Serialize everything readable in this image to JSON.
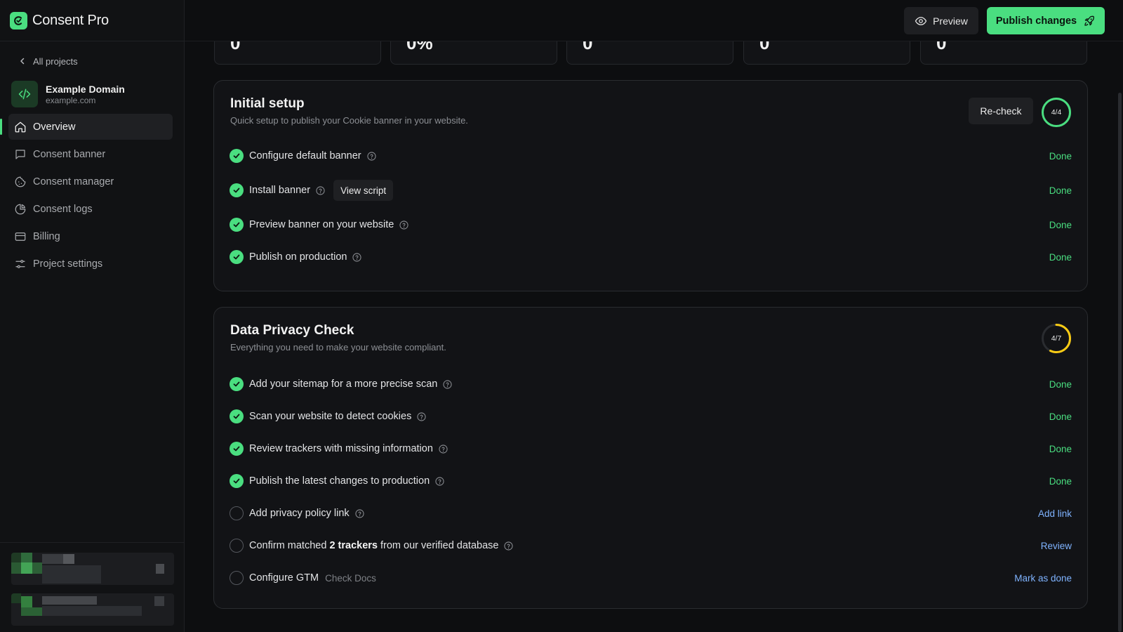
{
  "app": {
    "name": "Consent Pro"
  },
  "sidebar": {
    "back_label": "All projects",
    "project": {
      "name": "Example Domain",
      "domain": "example.com"
    },
    "items": [
      {
        "label": "Overview",
        "icon": "home-icon",
        "active": true
      },
      {
        "label": "Consent banner",
        "icon": "message-square-icon",
        "active": false
      },
      {
        "label": "Consent manager",
        "icon": "cookie-icon",
        "active": false
      },
      {
        "label": "Consent logs",
        "icon": "pie-chart-icon",
        "active": false
      },
      {
        "label": "Billing",
        "icon": "credit-card-icon",
        "active": false
      },
      {
        "label": "Project settings",
        "icon": "sliders-icon",
        "active": false
      }
    ]
  },
  "topbar": {
    "preview_label": "Preview",
    "publish_label": "Publish changes"
  },
  "stats": [
    {
      "value": "0"
    },
    {
      "value": "0%"
    },
    {
      "value": "0"
    },
    {
      "value": "0"
    },
    {
      "value": "0"
    }
  ],
  "initial_setup": {
    "title": "Initial setup",
    "subtitle": "Quick setup to publish your Cookie banner in your website.",
    "recheck_label": "Re-check",
    "progress_label": "4/4",
    "progress": 1.0,
    "tasks": [
      {
        "label": "Configure default banner",
        "status": "Done"
      },
      {
        "label": "Install banner",
        "chip": "View script",
        "status": "Done"
      },
      {
        "label": "Preview banner on your website",
        "status": "Done"
      },
      {
        "label": "Publish on production",
        "status": "Done"
      }
    ]
  },
  "privacy_check": {
    "title": "Data Privacy Check",
    "subtitle": "Everything you need to make your website compliant.",
    "progress_label": "4/7",
    "progress": 0.5714,
    "tasks": [
      {
        "label": "Add your sitemap for a more precise scan",
        "status": "Done"
      },
      {
        "label": "Scan your website to detect cookies",
        "status": "Done"
      },
      {
        "label": "Review trackers with missing information",
        "status": "Done"
      },
      {
        "label": "Publish the latest changes to production",
        "status": "Done"
      },
      {
        "label": "Add privacy policy link",
        "status": "Add link"
      },
      {
        "label_pre": "Confirm matched ",
        "label_bold": "2 trackers",
        "label_post": " from our verified database",
        "status": "Review"
      },
      {
        "label": "Configure GTM",
        "link": "Check Docs",
        "status": "Mark as done"
      }
    ]
  },
  "colors": {
    "accent": "#4ade80",
    "warning": "#facc15",
    "link": "#7fb3ff",
    "background": "#0d0e10"
  }
}
